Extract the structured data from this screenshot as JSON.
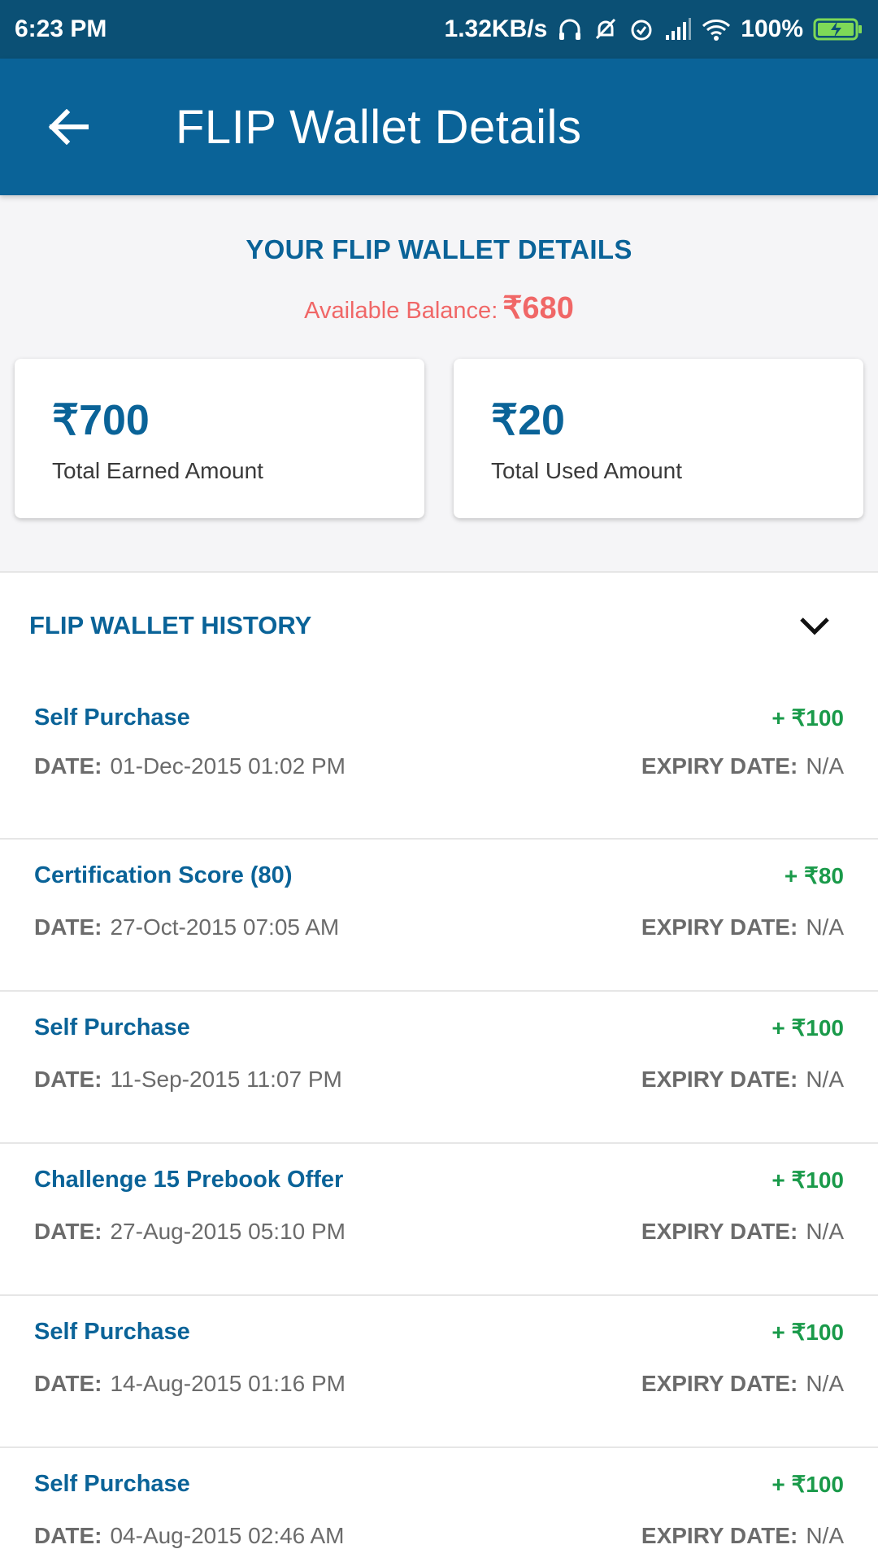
{
  "status": {
    "time": "6:23 PM",
    "speed": "1.32KB/s",
    "battery": "100%"
  },
  "appbar": {
    "title": "FLIP Wallet Details"
  },
  "summary": {
    "title": "YOUR FLIP WALLET DETAILS",
    "balance_label": "Available Balance:",
    "balance_value": "₹680",
    "earned_amount": "₹700",
    "earned_label": "Total Earned Amount",
    "used_amount": "₹20",
    "used_label": "Total Used Amount"
  },
  "history": {
    "title": "FLIP WALLET HISTORY",
    "date_label": "DATE:",
    "expiry_label": "EXPIRY DATE:",
    "items": [
      {
        "title": "Self Purchase",
        "amount": "+ ₹100",
        "date": "01-Dec-2015 01:02 PM",
        "expiry": "N/A"
      },
      {
        "title": "Certification Score (80)",
        "amount": "+ ₹80",
        "date": "27-Oct-2015 07:05 AM",
        "expiry": "N/A"
      },
      {
        "title": "Self Purchase",
        "amount": "+ ₹100",
        "date": "11-Sep-2015 11:07 PM",
        "expiry": "N/A"
      },
      {
        "title": "Challenge 15 Prebook Offer",
        "amount": "+ ₹100",
        "date": "27-Aug-2015 05:10 PM",
        "expiry": "N/A"
      },
      {
        "title": "Self Purchase",
        "amount": "+ ₹100",
        "date": "14-Aug-2015 01:16 PM",
        "expiry": "N/A"
      },
      {
        "title": "Self Purchase",
        "amount": "+ ₹100",
        "date": "04-Aug-2015 02:46 AM",
        "expiry": "N/A"
      }
    ]
  },
  "colors": {
    "appbar": "#0a6398",
    "statusbar": "#0b5075",
    "balance": "#f06767",
    "credit": "#1a9a4a"
  }
}
